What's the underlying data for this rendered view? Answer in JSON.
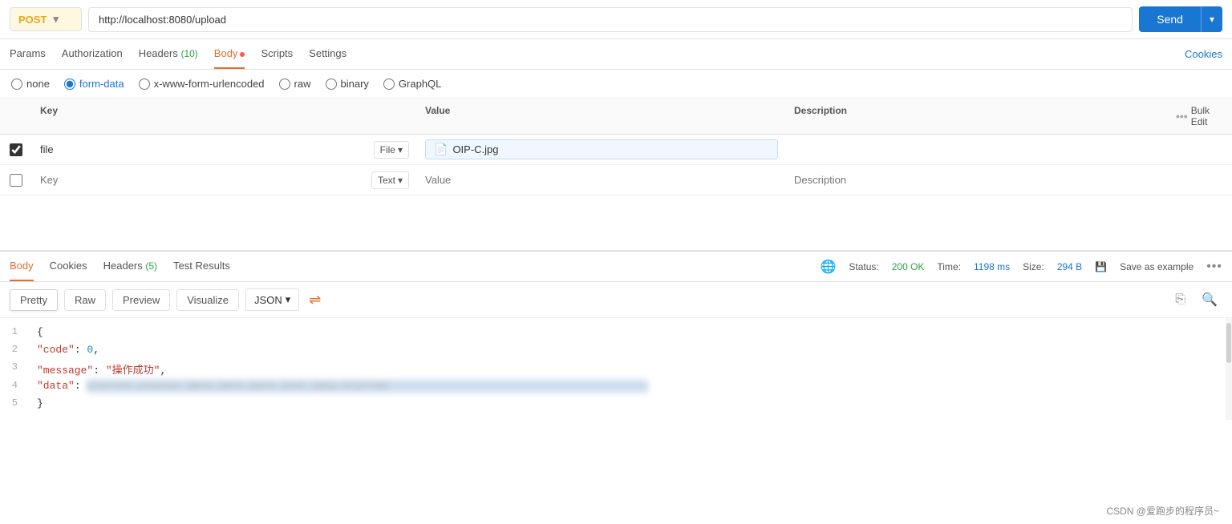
{
  "topbar": {
    "method": "POST",
    "url": "http://localhost:8080/upload",
    "send_label": "Send"
  },
  "nav": {
    "tabs": [
      {
        "id": "params",
        "label": "Params",
        "active": false,
        "badge": null
      },
      {
        "id": "authorization",
        "label": "Authorization",
        "active": false,
        "badge": null
      },
      {
        "id": "headers",
        "label": "Headers",
        "active": false,
        "badge": "10"
      },
      {
        "id": "body",
        "label": "Body",
        "active": true,
        "badge": null,
        "dot": true
      },
      {
        "id": "scripts",
        "label": "Scripts",
        "active": false,
        "badge": null
      },
      {
        "id": "settings",
        "label": "Settings",
        "active": false,
        "badge": null
      }
    ],
    "cookies_label": "Cookies"
  },
  "body_options": {
    "options": [
      {
        "id": "none",
        "label": "none",
        "selected": false
      },
      {
        "id": "form-data",
        "label": "form-data",
        "selected": true
      },
      {
        "id": "x-www-form-urlencoded",
        "label": "x-www-form-urlencoded",
        "selected": false
      },
      {
        "id": "raw",
        "label": "raw",
        "selected": false
      },
      {
        "id": "binary",
        "label": "binary",
        "selected": false
      },
      {
        "id": "graphql",
        "label": "GraphQL",
        "selected": false
      }
    ]
  },
  "table": {
    "headers": [
      "",
      "Key",
      "Value",
      "Description",
      "Bulk Edit"
    ],
    "rows": [
      {
        "checked": true,
        "key": "file",
        "type": "File",
        "value": "OIP-C.jpg",
        "description": "",
        "hasFile": true
      },
      {
        "checked": false,
        "key": "Key",
        "type": "Text",
        "value": "Value",
        "description": "Description",
        "hasFile": false,
        "placeholder": true
      }
    ],
    "bulk_edit_label": "Bulk Edit"
  },
  "response": {
    "tabs": [
      {
        "id": "body",
        "label": "Body",
        "active": true
      },
      {
        "id": "cookies",
        "label": "Cookies",
        "active": false
      },
      {
        "id": "headers",
        "label": "Headers",
        "active": false,
        "badge": "5"
      },
      {
        "id": "test_results",
        "label": "Test Results",
        "active": false
      }
    ],
    "status_label": "Status:",
    "status_value": "200 OK",
    "time_label": "Time:",
    "time_value": "1198 ms",
    "size_label": "Size:",
    "size_value": "294 B",
    "save_example_label": "Save as example"
  },
  "response_toolbar": {
    "views": [
      "Pretty",
      "Raw",
      "Preview",
      "Visualize"
    ],
    "active_view": "Pretty",
    "format": "JSON",
    "wrap_icon": "wrap"
  },
  "code": {
    "lines": [
      {
        "num": 1,
        "content": "{",
        "type": "bracket"
      },
      {
        "num": 2,
        "content": "\"code\": 0,",
        "type": "key-value"
      },
      {
        "num": 3,
        "content": "\"message\": \"操作成功\",",
        "type": "key-value"
      },
      {
        "num": 4,
        "content": "\"data\": [BLURRED_DATA]",
        "type": "key-value-blurred"
      },
      {
        "num": 5,
        "content": "}",
        "type": "bracket"
      }
    ]
  },
  "watermark": {
    "text": "CSDN @爱跑步的程序员~"
  }
}
